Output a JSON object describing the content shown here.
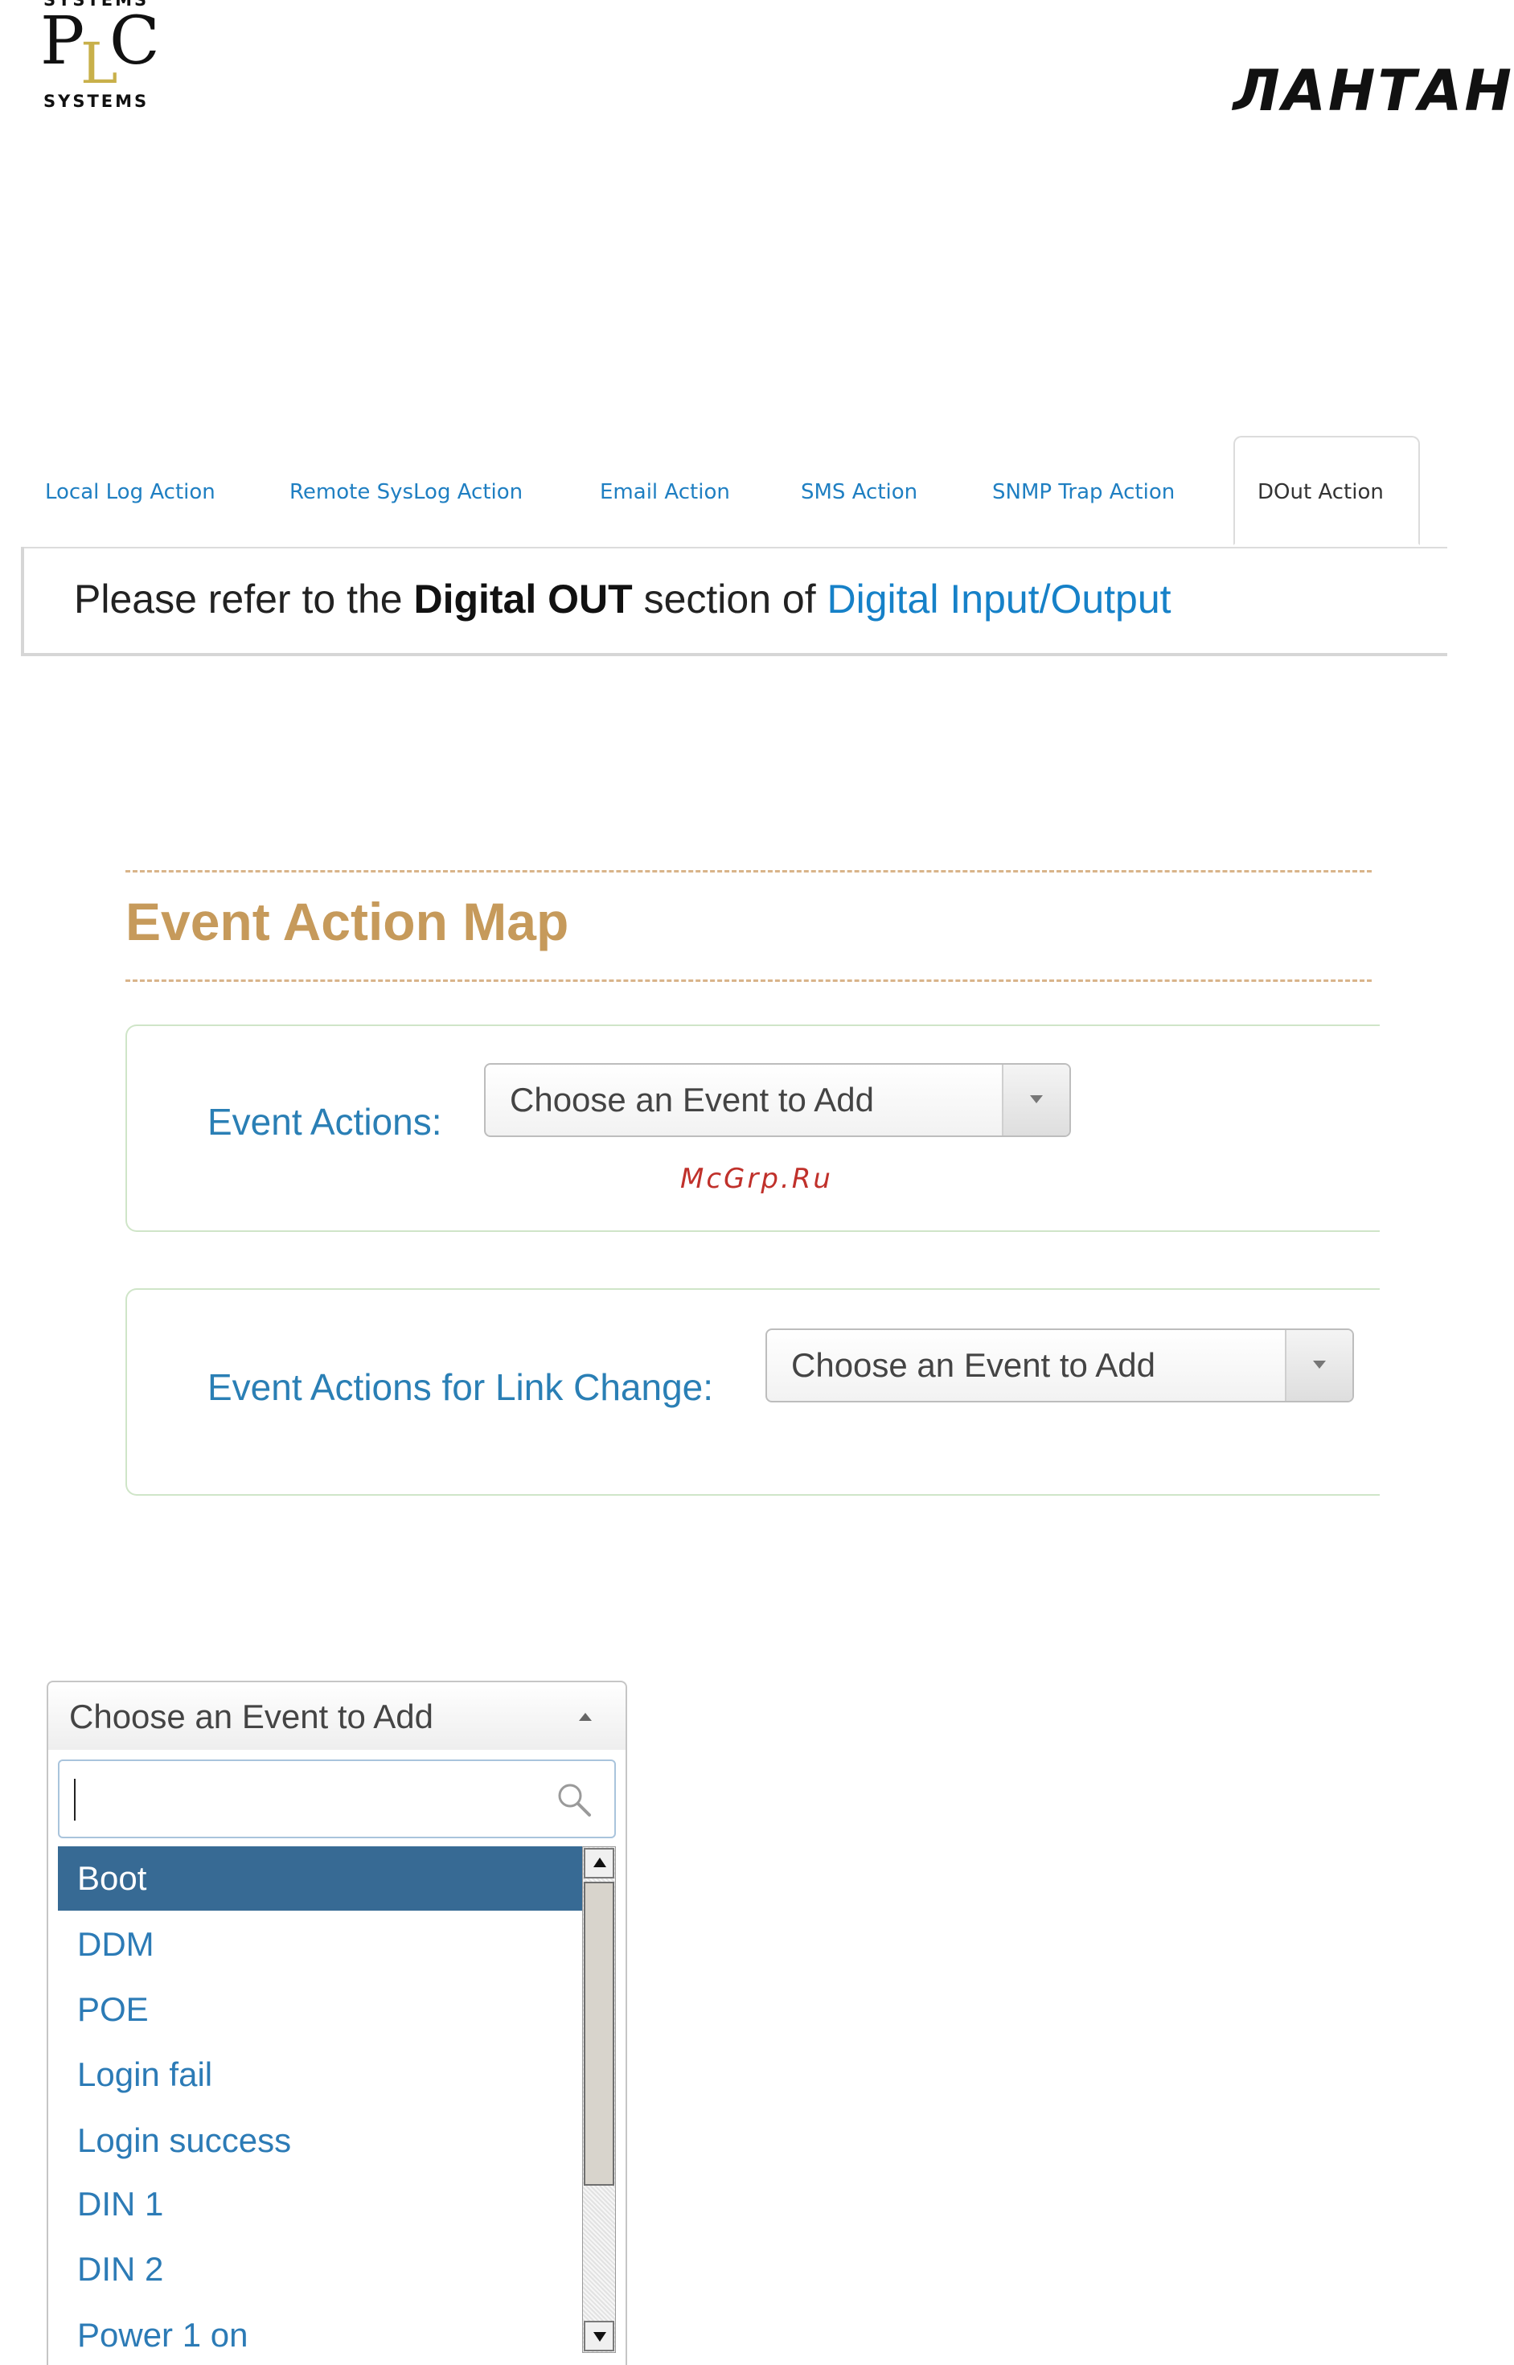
{
  "header": {
    "plc_logo": {
      "top_text": "SYSTEMS",
      "letters": [
        "P",
        "L",
        "C"
      ],
      "bottom_text": "SYSTEMS"
    },
    "brand_logo": "ЛАНТАН"
  },
  "tabs": {
    "items": [
      {
        "label": "Local Log Action"
      },
      {
        "label": "Remote SysLog Action"
      },
      {
        "label": "Email Action"
      },
      {
        "label": "SMS Action"
      },
      {
        "label": "SNMP Trap Action"
      },
      {
        "label": "DOut Action"
      }
    ],
    "active_index": 5,
    "panel": {
      "text_1": "Please refer to the",
      "strong": "Digital OUT",
      "text_2": "section of",
      "link": "Digital Input/Output"
    }
  },
  "event_map": {
    "title": "Event Action Map",
    "rows": [
      {
        "label": "Event Actions:",
        "select_value": "Choose an Event to Add"
      },
      {
        "label": "Event Actions for Link Change:",
        "select_value": "Choose an Event to Add"
      }
    ]
  },
  "watermark": "McGrp.Ru",
  "dropdown": {
    "selected_label": "Choose an Event to Add",
    "search_value": "",
    "options": [
      "Boot",
      "DDM",
      "POE",
      "Login fail",
      "Login success",
      "DIN 1",
      "DIN 2",
      "Power 1 on"
    ],
    "highlighted_index": 0
  },
  "colors": {
    "link_blue": "#1f7fc2",
    "title_gold": "#c69a5b",
    "label_blue": "#2a7fb5",
    "highlight_bg": "#376a94",
    "watermark_red": "#c0312b"
  },
  "icons": [
    "search-icon",
    "chevron-down-icon",
    "chevron-up-icon",
    "scroll-up-arrow-icon",
    "scroll-down-arrow-icon"
  ]
}
